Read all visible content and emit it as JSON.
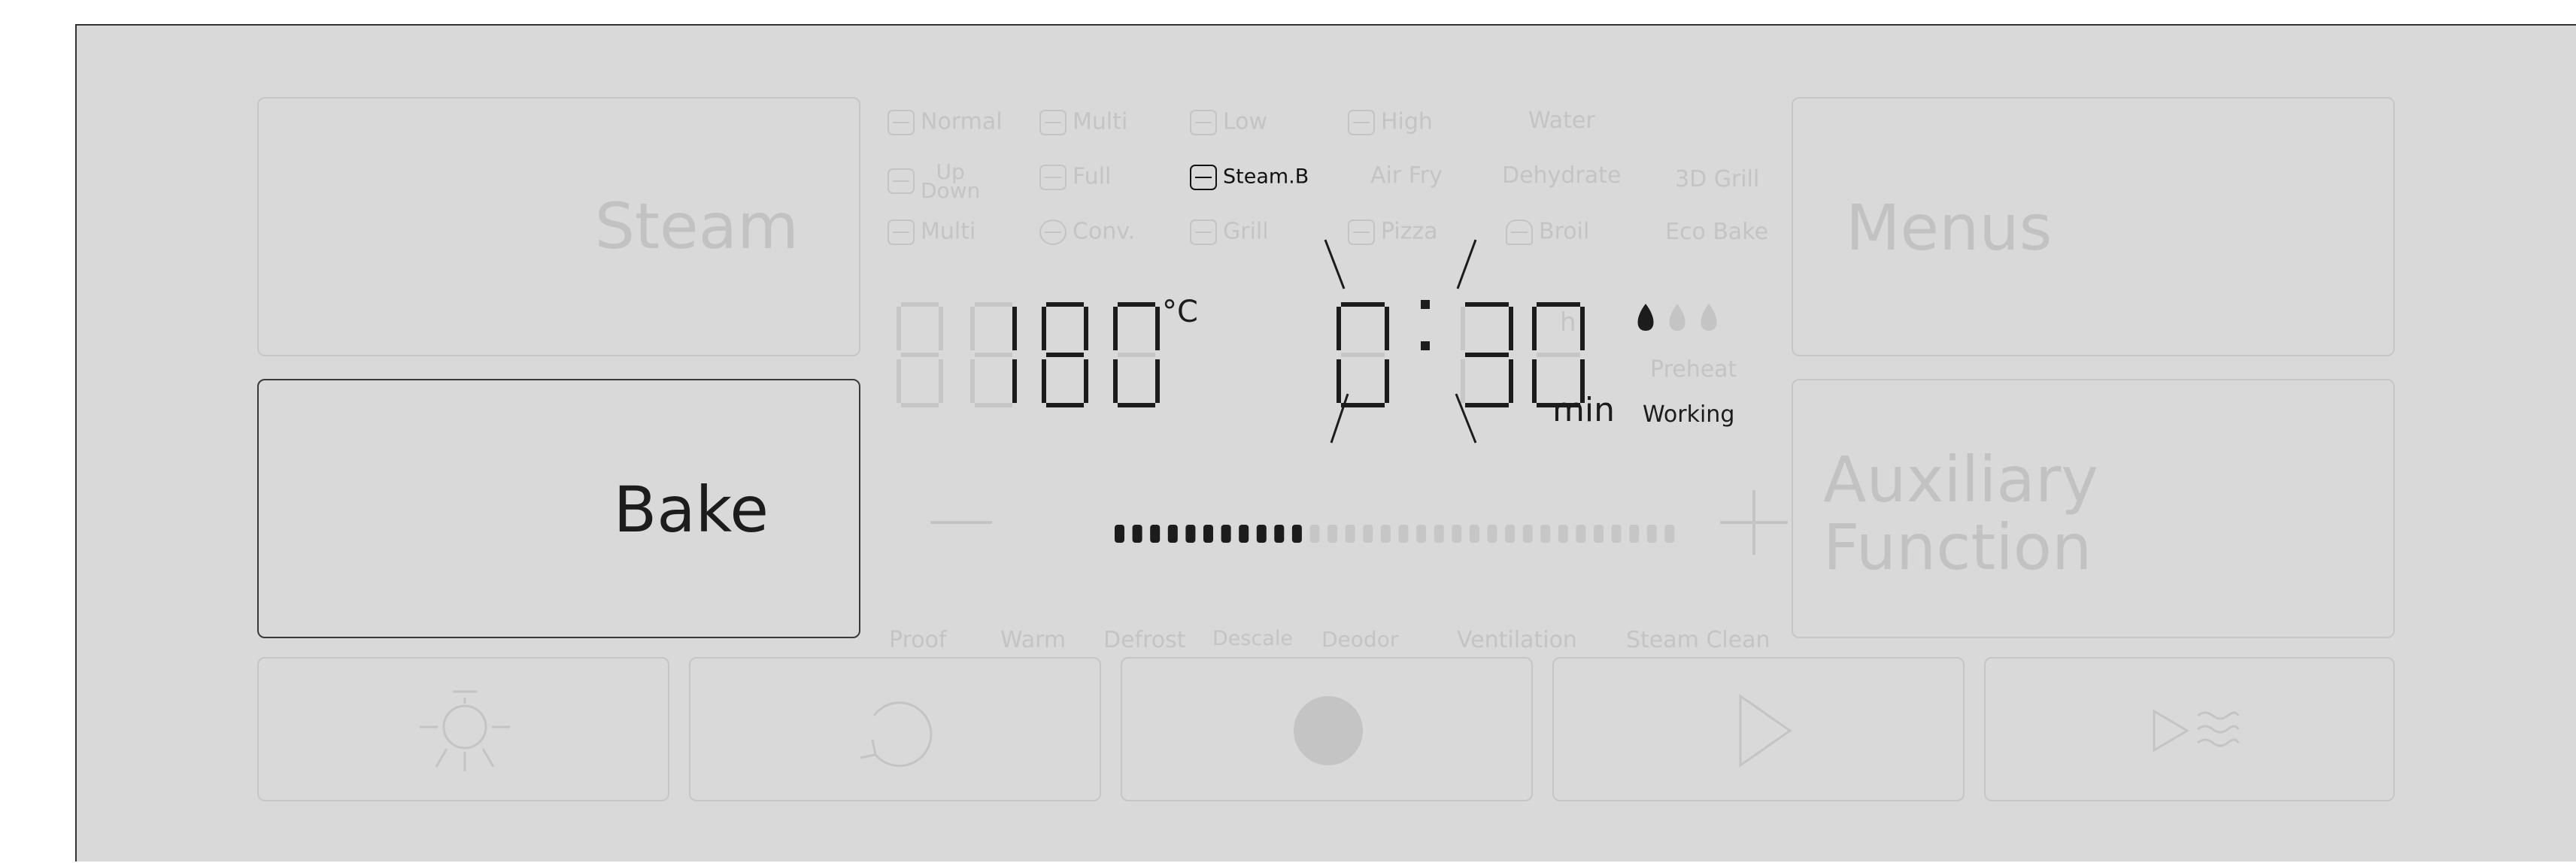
{
  "buttons": {
    "steam": "Steam",
    "bake": "Bake",
    "menus": "Menus",
    "auxiliary_line1": "Auxiliary",
    "auxiliary_line2": "Function"
  },
  "modes": {
    "normal": "Normal",
    "multi_top": "Multi",
    "low": "Low",
    "high": "High",
    "water": "Water",
    "up": "Up",
    "down": "Down",
    "full": "Full",
    "steam_b": "Steam.B",
    "air_fry": "Air Fry",
    "dehydrate": "Dehydrate",
    "grill_3d": "3D Grill",
    "multi_bottom": "Multi",
    "conv": "Conv.",
    "grill": "Grill",
    "pizza": "Pizza",
    "broil": "Broil",
    "eco_bake": "Eco Bake"
  },
  "active_mode": "Steam.B",
  "display": {
    "temperature": "180",
    "temp_unit": "°C",
    "time_hours": "0",
    "time_minutes": "30",
    "hour_unit": "h",
    "min_unit": "min",
    "preheat": "Preheat",
    "working": "Working",
    "steam_level": {
      "active": 1,
      "total": 3
    },
    "power_bar": {
      "active": 11,
      "total": 32
    }
  },
  "functions": [
    "Proof",
    "Warm",
    "Defrost",
    "Descale",
    "Deodor",
    "Ventilation",
    "Steam Clean"
  ],
  "bottom_icons": [
    "light-icon",
    "reset-icon",
    "stop-icon",
    "start-icon",
    "quick-start-icon"
  ],
  "colors": {
    "panel": "#d9d9d9",
    "active": "#1c1c1c",
    "inactive": "#c4c4c4"
  }
}
